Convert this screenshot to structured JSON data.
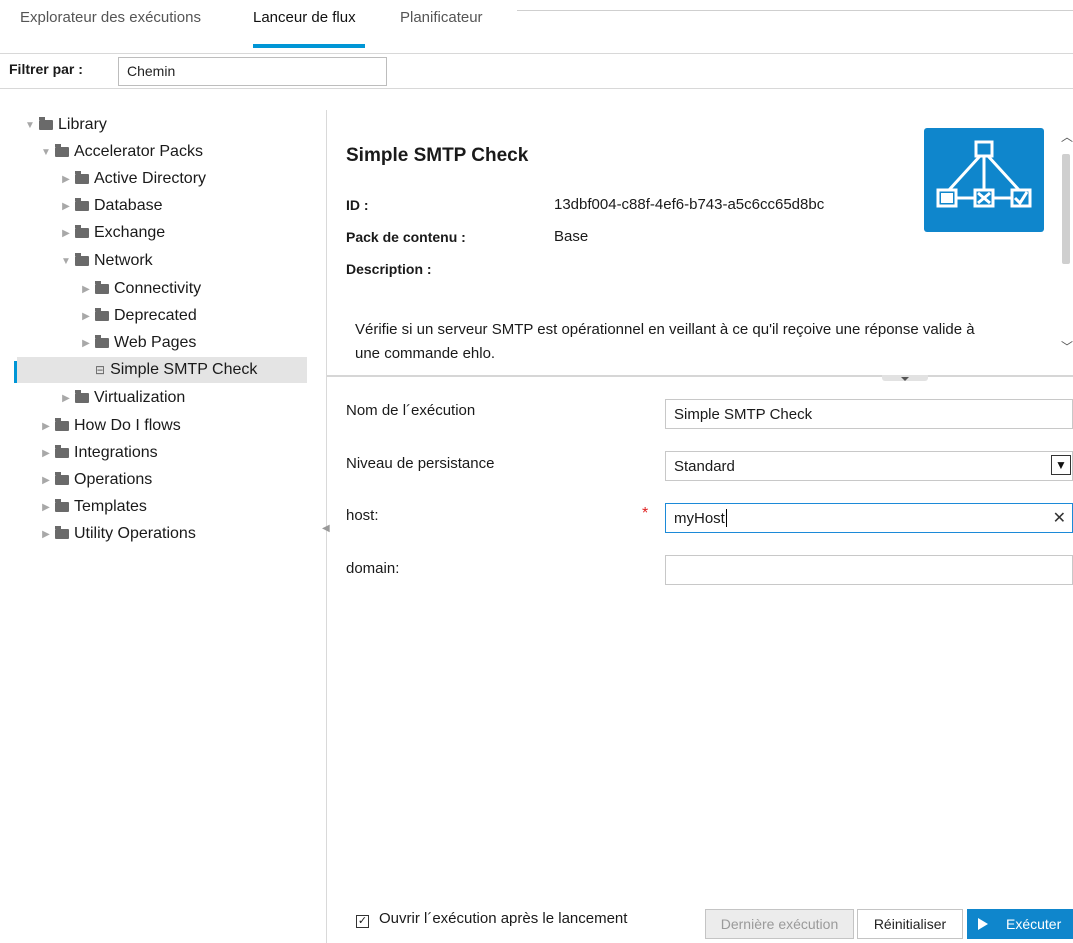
{
  "tabs": [
    "Explorateur des exécutions",
    "Lanceur de flux",
    "Planificateur"
  ],
  "active_tab": "Lanceur de flux",
  "filter": {
    "label": "Filtrer par :",
    "value": "Chemin"
  },
  "tree": [
    {
      "label": "Library",
      "expanded": true,
      "type": "folder"
    },
    {
      "label": "Accelerator Packs",
      "expanded": true,
      "type": "folder"
    },
    {
      "label": "Active Directory",
      "expanded": false,
      "type": "folder"
    },
    {
      "label": "Database",
      "expanded": false,
      "type": "folder"
    },
    {
      "label": "Exchange",
      "expanded": false,
      "type": "folder"
    },
    {
      "label": "Network",
      "expanded": true,
      "type": "folder"
    },
    {
      "label": "Connectivity",
      "expanded": false,
      "type": "folder"
    },
    {
      "label": "Deprecated",
      "expanded": false,
      "type": "folder"
    },
    {
      "label": "Web Pages",
      "expanded": false,
      "type": "folder"
    },
    {
      "label": "Simple SMTP Check",
      "type": "flow",
      "selected": true
    },
    {
      "label": "Virtualization",
      "expanded": false,
      "type": "folder"
    },
    {
      "label": "How Do I flows",
      "expanded": false,
      "type": "folder"
    },
    {
      "label": "Integrations",
      "expanded": false,
      "type": "folder"
    },
    {
      "label": "Operations",
      "expanded": false,
      "type": "folder"
    },
    {
      "label": "Templates",
      "expanded": false,
      "type": "folder"
    },
    {
      "label": "Utility Operations",
      "expanded": false,
      "type": "folder"
    }
  ],
  "details": {
    "title": "Simple SMTP Check",
    "id_label": "ID :",
    "id_value": "13dbf004-c88f-4ef6-b743-a5c6cc65d8bc",
    "pack_label": "Pack de contenu :",
    "pack_value": "Base",
    "description_label": "Description :",
    "description": "Vérifie si un serveur SMTP est opérationnel en veillant à ce qu'il reçoive une réponse valide à une commande  ehlo."
  },
  "form": {
    "run_name_label": "Nom de l´exécution",
    "run_name_value": "Simple SMTP Check",
    "persistence_label": "Niveau de persistance",
    "persistence_value": "Standard",
    "host_label": "host:",
    "host_value": "myHost",
    "host_required": "*",
    "domain_label": "domain:",
    "domain_value": ""
  },
  "bottom": {
    "checkbox_checked": true,
    "checkbox_label": "Ouvrir l´exécution après le lancement",
    "last_run_label": "Dernière exécution",
    "reset_label": "Réinitialiser",
    "run_label": "Exécuter"
  },
  "colors": {
    "accent": "#0096d6",
    "primary_button": "#0f86cc",
    "required": "#e02020"
  }
}
